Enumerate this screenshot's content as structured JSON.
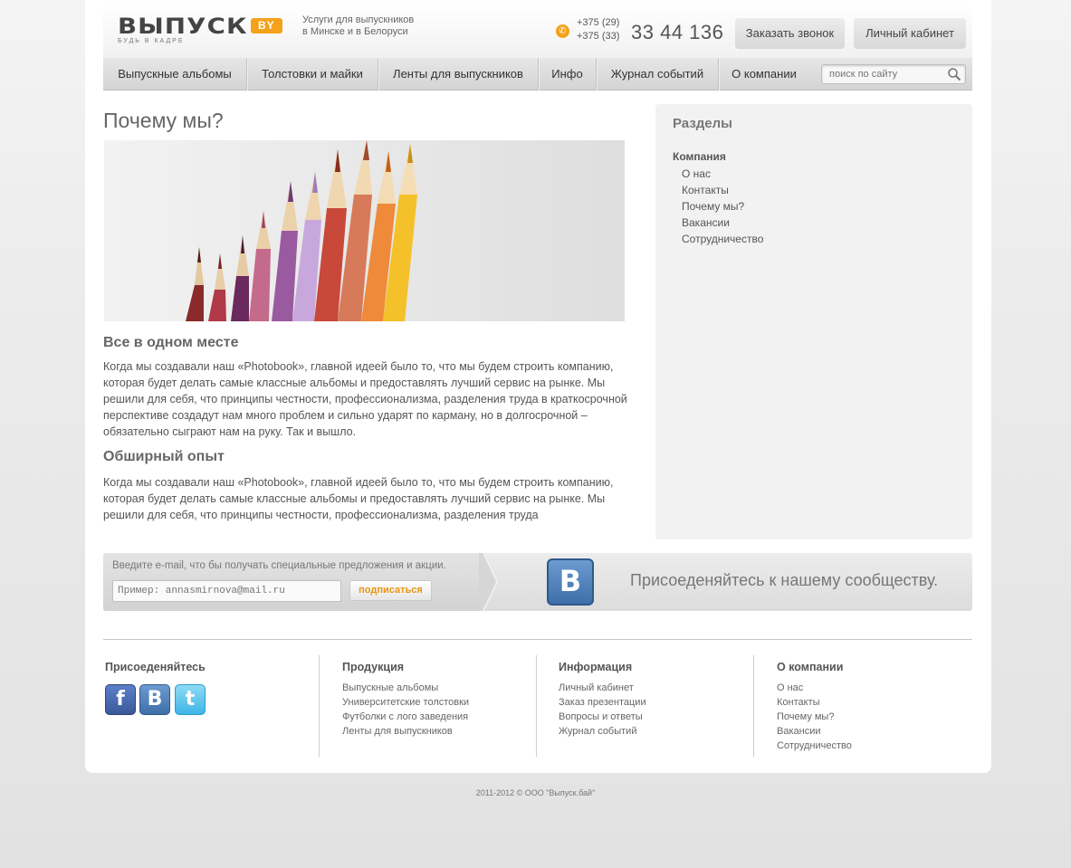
{
  "header": {
    "logo_text": "ВЫПУСК",
    "logo_badge": "BY",
    "logo_tagline": "БУДЬ В КАДРЕ",
    "desc_line1": "Услуги для выпускников",
    "desc_line2": "в Минске и в Белоруси",
    "phone_code1": "+375 (29)",
    "phone_code2": "+375 (33)",
    "phone_number": "33 44 136",
    "call_button": "Заказать звонок",
    "cabinet_button": "Личный кабинет"
  },
  "nav": {
    "items": [
      {
        "label": "Выпускные альбомы"
      },
      {
        "label": "Толстовки и майки"
      },
      {
        "label": "Ленты для выпускников"
      },
      {
        "label": "Инфо"
      },
      {
        "label": "Журнал событий"
      },
      {
        "label": "О компании"
      }
    ],
    "search_placeholder": "поиск по сайту"
  },
  "main": {
    "title": "Почему мы?",
    "section1_title": "Все в одном месте",
    "section1_text": "Когда мы создавали наш «Photobook», главной идеей было то, что мы будем строить компанию, которая будет делать самые классные альбомы и предоставлять лучший сервис на рынке. Мы решили для себя, что принципы честности, профессионализма, разделения труда в краткосрочной перспективе создадут нам много проблем и сильно ударят по карману, но в долгосрочной – обязательно сыграют нам на руку. Так и вышло.",
    "section2_title": "Обширный опыт",
    "section2_text": "Когда мы создавали наш «Photobook», главной идеей было то, что мы будем строить компанию, которая будет делать самые классные альбомы и предоставлять лучший сервис на рынке. Мы решили для себя, что принципы честности, профессионализма, разделения труда"
  },
  "sidebar": {
    "title": "Разделы",
    "group": "Компания",
    "items": [
      {
        "label": "О нас"
      },
      {
        "label": "Контакты"
      },
      {
        "label": "Почему мы?"
      },
      {
        "label": "Вакансии"
      },
      {
        "label": "Сотрудничество"
      }
    ]
  },
  "subscribe": {
    "label": "Введите e-mail, что бы получать специальные предложения и акции.",
    "placeholder": "Пример: annasmirnova@mail.ru",
    "button": "подписаться",
    "vk_letter": "B",
    "community_text": "Присоеденяйтесь к нашему сообществу."
  },
  "footer": {
    "join_title": "Присоеденяйтесь",
    "social": {
      "fb": "f",
      "vk": "B",
      "tw": "t"
    },
    "products_title": "Продукция",
    "products": [
      {
        "label": "Выпускные альбомы"
      },
      {
        "label": "Университетские толстовки"
      },
      {
        "label": "Футболки с лого заведения"
      },
      {
        "label": "Ленты для выпускников"
      }
    ],
    "info_title": "Информация",
    "info": [
      {
        "label": "Личный кабинет"
      },
      {
        "label": "Заказ презентации"
      },
      {
        "label": "Вопросы и ответы"
      },
      {
        "label": "Журнал событий"
      }
    ],
    "company_title": "О компании",
    "company": [
      {
        "label": "О нас"
      },
      {
        "label": "Контакты"
      },
      {
        "label": "Почему мы?"
      },
      {
        "label": "Вакансии"
      },
      {
        "label": "Сотрудничество"
      }
    ],
    "copyright": "2011-2012  ©  ООО \"Выпуск.бай\""
  },
  "colors": {
    "accent": "#f4a21a",
    "vk_blue": "#3f6fa8",
    "fb_blue": "#3b5998",
    "tw_blue": "#3eb5e6"
  }
}
